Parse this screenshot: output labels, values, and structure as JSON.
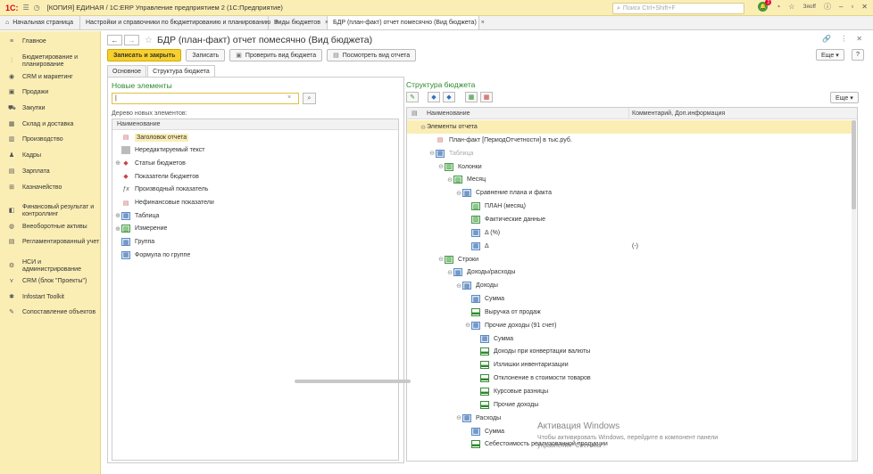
{
  "titlebar": {
    "logo": "1С:",
    "title": "[КОПИЯ] ЕДИНАЯ / 1С:ERP Управление предприятием 2  (1С:Предприятие)",
    "search_placeholder": "Поиск Ctrl+Shift+F",
    "user": "Зяоff",
    "notif_count": "2"
  },
  "tabs": [
    {
      "label": "Начальная страница"
    },
    {
      "label": "Настройки и справочники по бюджетированию и планированию",
      "close": "×"
    },
    {
      "label": "Виды  бюджетов",
      "close": "×"
    },
    {
      "label": "БДР (план-факт) отчет помесячно (Вид бюджета)",
      "close": "×"
    }
  ],
  "sidebar": [
    {
      "label": "Главное",
      "icon": "menu-icon"
    },
    {
      "label": "Бюджетирование и\nпланирование",
      "icon": "chart-icon"
    },
    {
      "label": "CRM и маркетинг",
      "icon": "crm-icon"
    },
    {
      "label": "Продажи",
      "icon": "sales-icon"
    },
    {
      "label": "Закупки",
      "icon": "cart-icon"
    },
    {
      "label": "Склад и доставка",
      "icon": "warehouse-icon"
    },
    {
      "label": "Производство",
      "icon": "factory-icon"
    },
    {
      "label": "Кадры",
      "icon": "people-icon"
    },
    {
      "label": "Зарплата",
      "icon": "salary-icon"
    },
    {
      "label": "Казначейство",
      "icon": "treasury-icon"
    },
    {
      "label": "Финансовый результат и\nконтроллинг",
      "icon": "finance-icon"
    },
    {
      "label": "Внеоборотные активы",
      "icon": "assets-icon"
    },
    {
      "label": "Регламентированный учет",
      "icon": "accounting-icon"
    },
    {
      "label": "НСИ и\nадминистрирование",
      "icon": "settings-icon"
    },
    {
      "label": "CRM (блок \"Проекты\")",
      "icon": "projects-icon"
    },
    {
      "label": "Infostart Toolkit",
      "icon": "tools-icon"
    },
    {
      "label": "Сопоставление объектов",
      "icon": "wrench-icon"
    }
  ],
  "page": {
    "title": "БДР (план-факт) отчет помесячно (Вид бюджета)",
    "back": "←",
    "forward": "→"
  },
  "toolbar": {
    "save_close": "Записать и закрыть",
    "save": "Записать",
    "check": "Проверить вид бюджета",
    "view": "Посмотреть вид отчета",
    "more": "Еще ▾",
    "help": "?"
  },
  "form_tabs": [
    "Основное",
    "Структура бюджета"
  ],
  "left": {
    "section_title": "Новые элементы",
    "input_value": "|",
    "tree_label": "Дерево новых элементов:",
    "col_name": "Наименование",
    "items": [
      {
        "label": "Заголовок отчета",
        "expand": "",
        "icon": "doc"
      },
      {
        "label": "Нередактируемый текст",
        "expand": "",
        "icon": "gray"
      },
      {
        "label": "Статьи бюджетов",
        "expand": "⊕",
        "icon": "r"
      },
      {
        "label": "Показатели бюджетов",
        "expand": "",
        "icon": "r"
      },
      {
        "label": "Производный показатель",
        "expand": "",
        "icon": "fx"
      },
      {
        "label": "Нефинансовые показатели",
        "expand": "",
        "icon": "doc"
      },
      {
        "label": "Таблица",
        "expand": "⊕",
        "icon": "tbl"
      },
      {
        "label": "Измерение",
        "expand": "⊕",
        "icon": "grn"
      },
      {
        "label": "Группа",
        "expand": "",
        "icon": "tbl"
      },
      {
        "label": "Формула по группе",
        "expand": "",
        "icon": "tbl"
      }
    ]
  },
  "right": {
    "section_title": "Структура бюджета",
    "more": "Еще ▾",
    "col_name": "Наименование",
    "col_comment": "Комментарий, Доп.информация",
    "rows": [
      {
        "label": "Элементы отчета",
        "expand": "⊖",
        "icon": "",
        "comment": ""
      },
      {
        "label": "План-факт [ПериодОтчетности] в тыс.руб.",
        "expand": "",
        "icon": "doc",
        "comment": ""
      },
      {
        "label": "Таблица",
        "expand": "⊖",
        "icon": "tbl",
        "comment": ""
      },
      {
        "label": "Колонки",
        "expand": "⊖",
        "icon": "grn",
        "comment": ""
      },
      {
        "label": "Месяц",
        "expand": "⊖",
        "icon": "grn",
        "comment": ""
      },
      {
        "label": "Сравнение плана и факта",
        "expand": "⊖",
        "icon": "tbl",
        "comment": ""
      },
      {
        "label": "ПЛАН (месяц)",
        "expand": "",
        "icon": "grn",
        "comment": ""
      },
      {
        "label": "Фактические данные",
        "expand": "",
        "icon": "grn",
        "comment": ""
      },
      {
        "label": "Δ (%)",
        "expand": "",
        "icon": "tbl",
        "comment": ""
      },
      {
        "label": "Δ",
        "expand": "",
        "icon": "tbl",
        "comment": "(-)"
      },
      {
        "label": "Строки",
        "expand": "⊖",
        "icon": "grn",
        "comment": ""
      },
      {
        "label": "Доходы/расходы",
        "expand": "⊖",
        "icon": "tbl",
        "comment": ""
      },
      {
        "label": "Доходы",
        "expand": "⊖",
        "icon": "tbl",
        "comment": ""
      },
      {
        "label": "Сумма",
        "expand": "",
        "icon": "tbl",
        "comment": ""
      },
      {
        "label": "Выручка от продаж",
        "expand": "",
        "icon": "bar",
        "comment": ""
      },
      {
        "label": "Прочие доходы (91 счет)",
        "expand": "⊖",
        "icon": "tbl",
        "comment": ""
      },
      {
        "label": "Сумма",
        "expand": "",
        "icon": "tbl",
        "comment": ""
      },
      {
        "label": "Доходы при конвертации валюты",
        "expand": "",
        "icon": "bar",
        "comment": ""
      },
      {
        "label": "Излишки инвентаризации",
        "expand": "",
        "icon": "bar",
        "comment": ""
      },
      {
        "label": "Отклонение в стоимости товаров",
        "expand": "",
        "icon": "bar",
        "comment": ""
      },
      {
        "label": "Курсовые разницы",
        "expand": "",
        "icon": "bar",
        "comment": ""
      },
      {
        "label": "Прочие доходы",
        "expand": "",
        "icon": "bar",
        "comment": ""
      },
      {
        "label": "Расходы",
        "expand": "⊖",
        "icon": "tbl",
        "comment": ""
      },
      {
        "label": "Сумма",
        "expand": "",
        "icon": "tbl",
        "comment": ""
      },
      {
        "label": "Себестоимость реализованной продукции",
        "expand": "",
        "icon": "bar",
        "comment": ""
      }
    ]
  },
  "watermark": {
    "title": "Активация Windows",
    "subtitle": "Чтобы активировать Windows, перейдите в компонент панели\nуправления \"Система\"."
  }
}
